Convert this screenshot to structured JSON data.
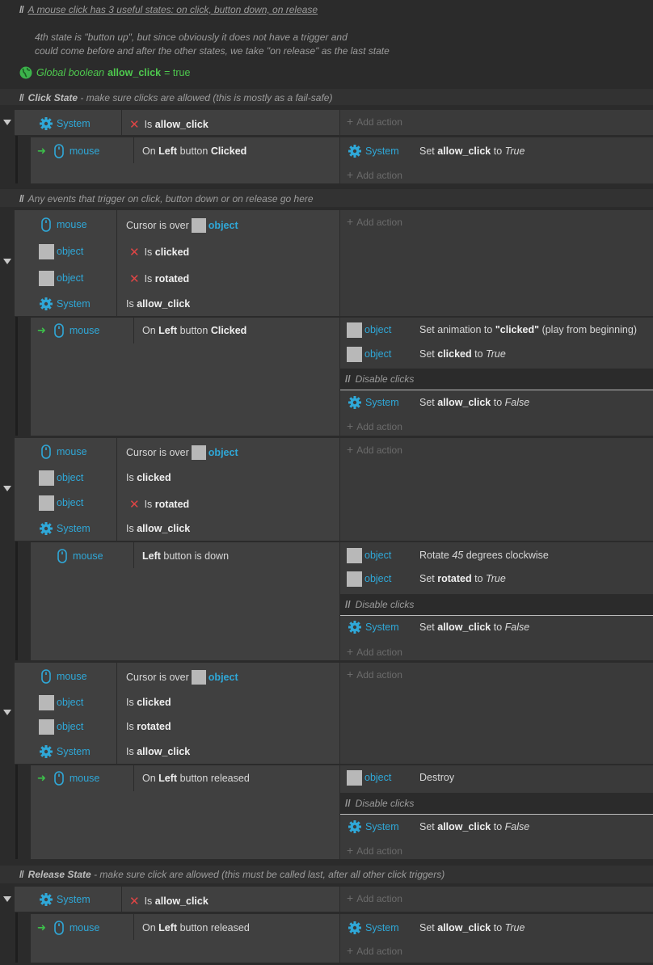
{
  "header": {
    "comment1": "A mouse click has 3 useful states: on click, button down, on release",
    "comment2": "4th state is \"button up\", but since obviously it does not have a trigger and",
    "comment3": "could come before and after the other states, we take \"on release\" as the last state",
    "global_prefix": "Global boolean",
    "global_name": "allow_click",
    "global_eq": "= true"
  },
  "labels": {
    "slash": "//",
    "system": "System",
    "mouse": "mouse",
    "object": "object",
    "add_action": "Add action",
    "is": "Is",
    "allow_click": "allow_click",
    "clicked": "clicked",
    "rotated": "rotated",
    "on": "On",
    "left": "Left",
    "button": "button",
    "clicked_word": "Clicked",
    "released": "released",
    "cursor_is_over": "Cursor is over",
    "is_down": "button is down",
    "set": "Set",
    "to": "to",
    "true": "True",
    "false": "False",
    "disable_clicks": "Disable clicks",
    "destroy": "Destroy",
    "set_anim": "Set animation to",
    "anim_name": "\"clicked\"",
    "anim_tail": "(play from beginning)",
    "rotate": "Rotate",
    "deg": "45",
    "deg_tail": "degrees clockwise"
  },
  "sections": {
    "click_state_title": "Click State",
    "click_state_desc": "- make sure clicks are allowed (this is mostly as a fail-safe)",
    "any_events": "Any events that trigger on click, button down or on release go here",
    "release_title": "Release State",
    "release_desc": "- make sure click are allowed (this must be called last, after all other click triggers)"
  },
  "colors": {
    "accent": "#2fa8d8",
    "trigger": "#3cc04a",
    "invert": "#e04545",
    "global": "#4ec94e"
  }
}
